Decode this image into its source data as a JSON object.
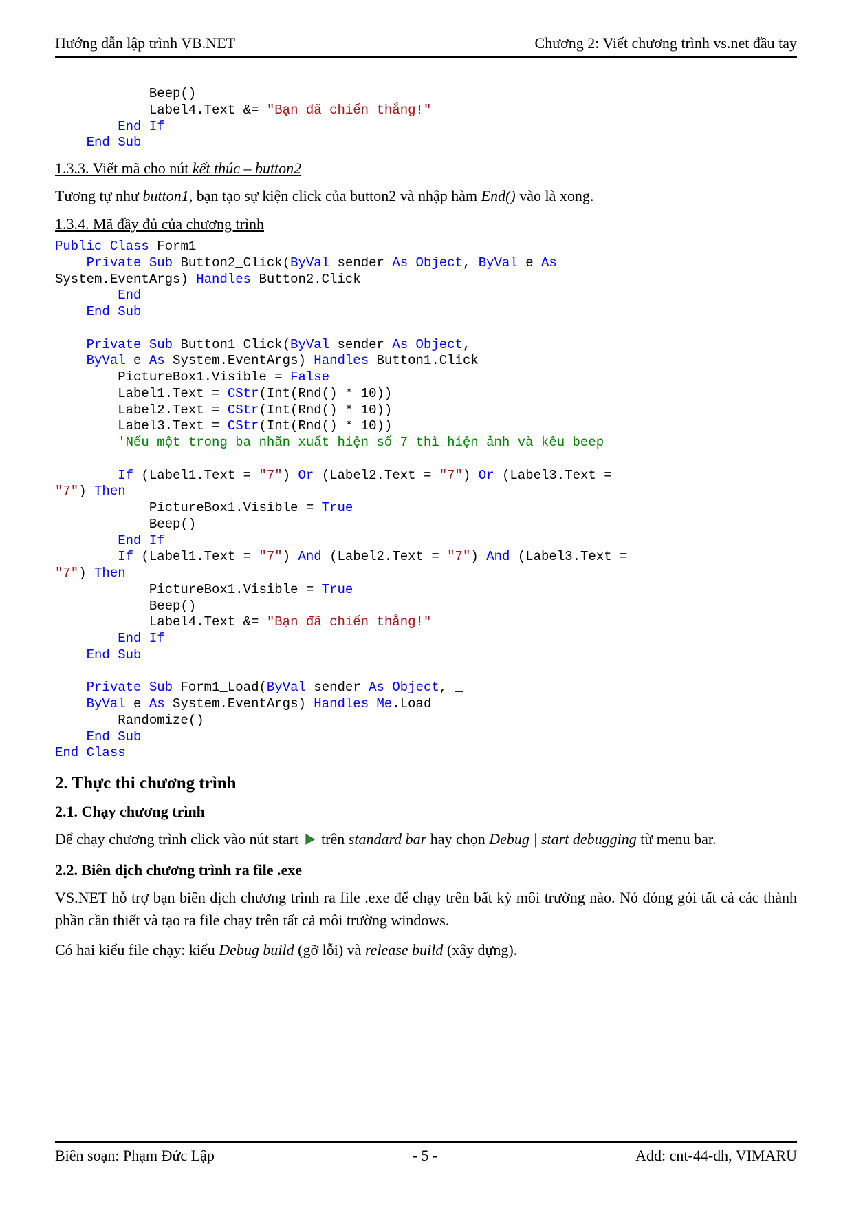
{
  "header": {
    "left": "Hướng dẫn lập trình VB.NET",
    "right": "Chương 2: Viết chương trình vs.net đầu tay"
  },
  "code1": {
    "l1a": "            Beep()",
    "l2a": "            Label4.Text &= ",
    "l2b": "\"Bạn đã chiến thắng!\"",
    "l3a": "        ",
    "l3b": "End",
    "l3c": " ",
    "l3d": "If",
    "l4a": "    ",
    "l4b": "End",
    "l4c": " ",
    "l4d": "Sub"
  },
  "sec133": {
    "t1": "1.3.3. Viết mã cho nút ",
    "t2": "kết thúc – button2"
  },
  "para1": {
    "t1": "Tương tự như ",
    "t2": "button1",
    "t3": ", bạn tạo sự kiện click của button2 và nhập hàm ",
    "t4": "End()",
    "t5": " vào là xong."
  },
  "sec134": "1.3.4. Mã đầy đủ của chương trình",
  "code2": {
    "l01a": "Public",
    "l01b": " ",
    "l01c": "Class",
    "l01d": " Form1",
    "l02a": "    ",
    "l02b": "Private",
    "l02c": " ",
    "l02d": "Sub",
    "l02e": " Button2_Click(",
    "l02f": "ByVal",
    "l02g": " sender ",
    "l02h": "As",
    "l02i": " ",
    "l02j": "Object",
    "l02k": ", ",
    "l02l": "ByVal",
    "l02m": " e ",
    "l02n": "As",
    "l03a": "System.EventArgs) ",
    "l03b": "Handles",
    "l03c": " Button2.Click",
    "l04a": "        ",
    "l04b": "End",
    "l05a": "    ",
    "l05b": "End",
    "l05c": " ",
    "l05d": "Sub",
    "blank1": "",
    "l06a": "    ",
    "l06b": "Private",
    "l06c": " ",
    "l06d": "Sub",
    "l06e": " Button1_Click(",
    "l06f": "ByVal",
    "l06g": " sender ",
    "l06h": "As",
    "l06i": " ",
    "l06j": "Object",
    "l06k": ", _",
    "l07a": "    ",
    "l07b": "ByVal",
    "l07c": " e ",
    "l07d": "As",
    "l07e": " System.EventArgs) ",
    "l07f": "Handles",
    "l07g": " Button1.Click",
    "l08a": "        PictureBox1.Visible = ",
    "l08b": "False",
    "l09a": "        Label1.Text = ",
    "l09b": "CStr",
    "l09c": "(Int(Rnd() * 10))",
    "l10a": "        Label2.Text = ",
    "l10b": "CStr",
    "l10c": "(Int(Rnd() * 10))",
    "l11a": "        Label3.Text = ",
    "l11b": "CStr",
    "l11c": "(Int(Rnd() * 10))",
    "l12a": "        ",
    "l12b": "'Nếu một trong ba nhãn xuất hiện số 7 thì hiện ảnh và kêu beep",
    "blank2": "",
    "l13a": "        ",
    "l13b": "If",
    "l13c": " (Label1.Text = ",
    "l13d": "\"7\"",
    "l13e": ") ",
    "l13f": "Or",
    "l13g": " (Label2.Text = ",
    "l13h": "\"7\"",
    "l13i": ") ",
    "l13j": "Or",
    "l13k": " (Label3.Text = ",
    "l14a": "\"7\"",
    "l14b": ") ",
    "l14c": "Then",
    "l15a": "            PictureBox1.Visible = ",
    "l15b": "True",
    "l16a": "            Beep()",
    "l17a": "        ",
    "l17b": "End",
    "l17c": " ",
    "l17d": "If",
    "l18a": "        ",
    "l18b": "If",
    "l18c": " (Label1.Text = ",
    "l18d": "\"7\"",
    "l18e": ") ",
    "l18f": "And",
    "l18g": " (Label2.Text = ",
    "l18h": "\"7\"",
    "l18i": ") ",
    "l18j": "And",
    "l18k": " (Label3.Text = ",
    "l19a": "\"7\"",
    "l19b": ") ",
    "l19c": "Then",
    "l20a": "            PictureBox1.Visible = ",
    "l20b": "True",
    "l21a": "            Beep()",
    "l22a": "            Label4.Text &= ",
    "l22b": "\"Bạn đã chiến thắng!\"",
    "l23a": "        ",
    "l23b": "End",
    "l23c": " ",
    "l23d": "If",
    "l24a": "    ",
    "l24b": "End",
    "l24c": " ",
    "l24d": "Sub",
    "blank3": "",
    "l25a": "    ",
    "l25b": "Private",
    "l25c": " ",
    "l25d": "Sub",
    "l25e": " Form1_Load(",
    "l25f": "ByVal",
    "l25g": " sender ",
    "l25h": "As",
    "l25i": " ",
    "l25j": "Object",
    "l25k": ", _",
    "l26a": "    ",
    "l26b": "ByVal",
    "l26c": " e ",
    "l26d": "As",
    "l26e": " System.EventArgs) ",
    "l26f": "Handles",
    "l26g": " ",
    "l26h": "Me",
    "l26i": ".Load",
    "l27a": "        Randomize()",
    "l28a": "    ",
    "l28b": "End",
    "l28c": " ",
    "l28d": "Sub",
    "l29a": "End",
    "l29b": " ",
    "l29c": "Class"
  },
  "h2_2": "2. Thực thi chương trình",
  "h3_21": "2.1. Chạy chương trình",
  "para21": {
    "t1": "Để chạy chương trình click vào nút start ",
    "t2": " trên ",
    "t3": "standard bar",
    "t4": " hay chọn ",
    "t5": "Debug | start debugging",
    "t6": " từ menu bar."
  },
  "h3_22": "2.2. Biên dịch chương trình ra file .exe",
  "para22a": "VS.NET hỗ trợ bạn biên dịch chương trình ra file .exe để chạy trên bất kỳ môi trường nào. Nó đóng gói tất cả các thành phần cần thiết và tạo ra file chạy trên tất cả môi trường windows.",
  "para22b": {
    "t1": "Có hai kiểu file chạy: kiểu ",
    "t2": "Debug build",
    "t3": " (gỡ lỗi) và  ",
    "t4": "release build",
    "t5": " (xây dựng)."
  },
  "footer": {
    "left": "Biên soạn: Phạm Đức Lập",
    "center": "- 5 -",
    "right": "Add: cnt-44-dh, VIMARU"
  }
}
